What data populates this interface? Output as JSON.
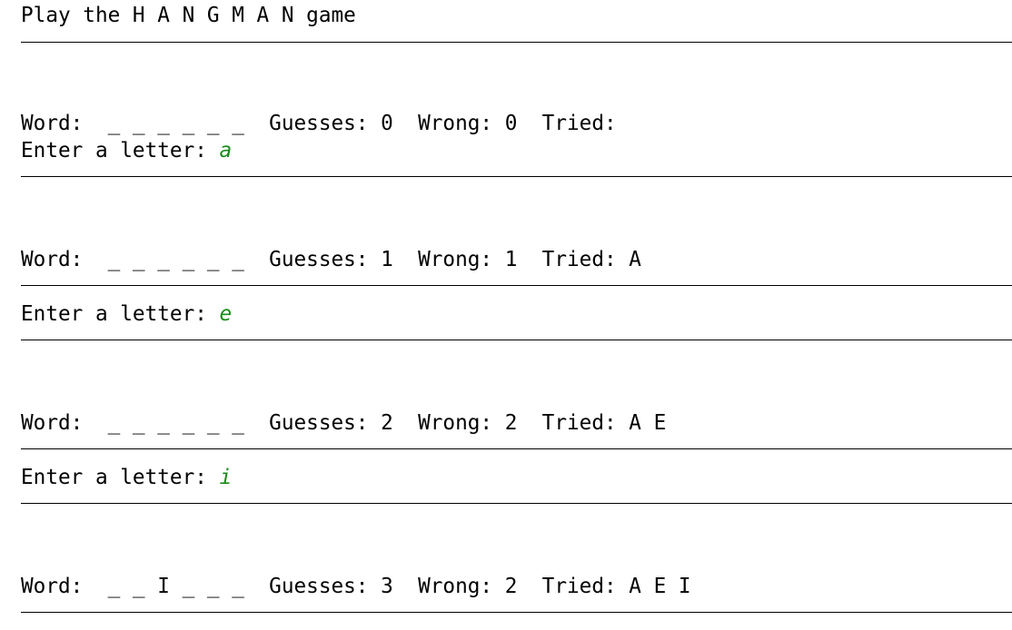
{
  "terminal": {
    "title_line": "Play the H A N G M A N game",
    "prompt_label": "Enter a letter: ",
    "input_color": "#1a8a1a",
    "rounds": [
      {
        "status": "Word:  _ _ _ _ _ _  Guesses: 0  Wrong: 0  Tried:",
        "input": "a"
      },
      {
        "status": "Word:  _ _ _ _ _ _  Guesses: 1  Wrong: 1  Tried: A",
        "input": "e"
      },
      {
        "status": "Word:  _ _ _ _ _ _  Guesses: 2  Wrong: 2  Tried: A E",
        "input": "i"
      },
      {
        "status": "Word:  _ _ I _ _ _  Guesses: 3  Wrong: 2  Tried: A E I"
      }
    ]
  }
}
